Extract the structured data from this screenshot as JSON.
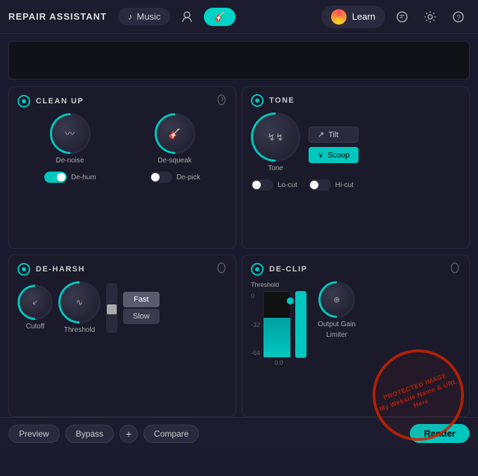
{
  "app": {
    "title": "REPAIR ASSISTANT",
    "music_label": "Music",
    "learn_label": "Learn"
  },
  "cleanup": {
    "title": "CLEAN UP",
    "denoise_label": "De-noise",
    "desqueak_label": "De-squeak",
    "dehum_label": "De-hum",
    "depick_label": "De-pick",
    "dehum_on": true,
    "depick_on": false
  },
  "tone": {
    "title": "TONE",
    "tone_label": "Tone",
    "tilt_label": "Tilt",
    "scoop_label": "Scoop",
    "locut_label": "Lo-cut",
    "hicut_label": "Hi-cut",
    "locut_on": false,
    "hicut_on": false
  },
  "deharsh": {
    "title": "DE-HARSH",
    "cutoff_label": "Cutoff",
    "threshold_label": "Threshold",
    "fast_label": "Fast",
    "slow_label": "Slow"
  },
  "declip": {
    "title": "DE-CLIP",
    "threshold_label": "Threshold",
    "output_gain_label": "Output Gain",
    "limiter_label": "Limiter",
    "db_0": "0",
    "db_32": "-32",
    "db_64": "-64",
    "meter_value": "0.0"
  },
  "footer": {
    "preview_label": "Preview",
    "bypass_label": "Bypass",
    "plus_label": "+",
    "compare_label": "Compare",
    "render_label": "Render"
  },
  "watermark": {
    "line1": "PROTECTED IMAGE",
    "line2": "My Website Name & URL Here"
  }
}
